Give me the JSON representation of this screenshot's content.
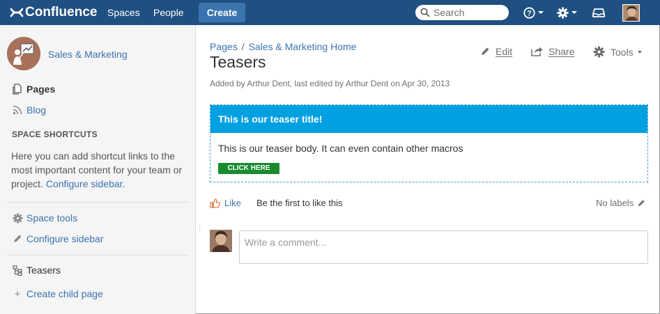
{
  "header": {
    "logo_text": "Confluence",
    "nav": [
      "Spaces",
      "People"
    ],
    "create_label": "Create",
    "search_placeholder": "Search",
    "icons": [
      "help-icon",
      "gear-icon",
      "inbox-icon",
      "user-avatar"
    ]
  },
  "sidebar": {
    "space_name": "Sales & Marketing",
    "nav_items": [
      {
        "label": "Pages",
        "icon": "pages-icon"
      },
      {
        "label": "Blog",
        "icon": "rss-icon"
      }
    ],
    "shortcuts_heading": "SPACE SHORTCUTS",
    "shortcuts_text": "Here you can add shortcut links to the most important content for your team or project.",
    "configure_link": "Configure sidebar",
    "tools": [
      {
        "label": "Space tools",
        "icon": "gear-icon"
      },
      {
        "label": "Configure sidebar",
        "icon": "pencil-icon"
      }
    ],
    "tree_item": "Teasers",
    "create_child": "Create child page"
  },
  "main": {
    "breadcrumb": [
      "Pages",
      "Sales & Marketing Home"
    ],
    "breadcrumb_sep": "/",
    "title": "Teasers",
    "meta": {
      "added_by_prefix": "Added by",
      "author": "Arthur Dent",
      "edited_prefix": ", last edited by",
      "editor": "Arthur Dent",
      "on": "on Apr 30, 2013"
    },
    "actions": {
      "edit": "Edit",
      "share": "Share",
      "tools": "Tools"
    },
    "teaser": {
      "title": "This is our teaser title!",
      "body": "This is our teaser body. It can even contain other macros",
      "button": "CLICK HERE"
    },
    "like_label": "Like",
    "like_text": "Be the first to like this",
    "labels_text": "No labels",
    "comment_placeholder": "Write a comment..."
  },
  "colors": {
    "header_bg": "#205081",
    "create_bg": "#3b73af",
    "link": "#3b73af",
    "teaser_bg": "#00a0e1",
    "teaser_button": "#1a8a2e"
  }
}
